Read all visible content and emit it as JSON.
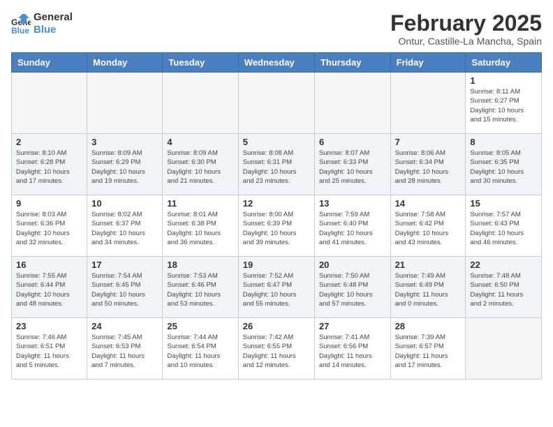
{
  "logo": {
    "line1": "General",
    "line2": "Blue"
  },
  "title": "February 2025",
  "subtitle": "Ontur, Castille-La Mancha, Spain",
  "days_of_week": [
    "Sunday",
    "Monday",
    "Tuesday",
    "Wednesday",
    "Thursday",
    "Friday",
    "Saturday"
  ],
  "weeks": [
    {
      "days": [
        {
          "num": "",
          "info": ""
        },
        {
          "num": "",
          "info": ""
        },
        {
          "num": "",
          "info": ""
        },
        {
          "num": "",
          "info": ""
        },
        {
          "num": "",
          "info": ""
        },
        {
          "num": "",
          "info": ""
        },
        {
          "num": "1",
          "info": "Sunrise: 8:11 AM\nSunset: 6:27 PM\nDaylight: 10 hours\nand 15 minutes."
        }
      ]
    },
    {
      "days": [
        {
          "num": "2",
          "info": "Sunrise: 8:10 AM\nSunset: 6:28 PM\nDaylight: 10 hours\nand 17 minutes."
        },
        {
          "num": "3",
          "info": "Sunrise: 8:09 AM\nSunset: 6:29 PM\nDaylight: 10 hours\nand 19 minutes."
        },
        {
          "num": "4",
          "info": "Sunrise: 8:09 AM\nSunset: 6:30 PM\nDaylight: 10 hours\nand 21 minutes."
        },
        {
          "num": "5",
          "info": "Sunrise: 8:08 AM\nSunset: 6:31 PM\nDaylight: 10 hours\nand 23 minutes."
        },
        {
          "num": "6",
          "info": "Sunrise: 8:07 AM\nSunset: 6:33 PM\nDaylight: 10 hours\nand 25 minutes."
        },
        {
          "num": "7",
          "info": "Sunrise: 8:06 AM\nSunset: 6:34 PM\nDaylight: 10 hours\nand 28 minutes."
        },
        {
          "num": "8",
          "info": "Sunrise: 8:05 AM\nSunset: 6:35 PM\nDaylight: 10 hours\nand 30 minutes."
        }
      ]
    },
    {
      "days": [
        {
          "num": "9",
          "info": "Sunrise: 8:03 AM\nSunset: 6:36 PM\nDaylight: 10 hours\nand 32 minutes."
        },
        {
          "num": "10",
          "info": "Sunrise: 8:02 AM\nSunset: 6:37 PM\nDaylight: 10 hours\nand 34 minutes."
        },
        {
          "num": "11",
          "info": "Sunrise: 8:01 AM\nSunset: 6:38 PM\nDaylight: 10 hours\nand 36 minutes."
        },
        {
          "num": "12",
          "info": "Sunrise: 8:00 AM\nSunset: 6:39 PM\nDaylight: 10 hours\nand 39 minutes."
        },
        {
          "num": "13",
          "info": "Sunrise: 7:59 AM\nSunset: 6:40 PM\nDaylight: 10 hours\nand 41 minutes."
        },
        {
          "num": "14",
          "info": "Sunrise: 7:58 AM\nSunset: 6:42 PM\nDaylight: 10 hours\nand 43 minutes."
        },
        {
          "num": "15",
          "info": "Sunrise: 7:57 AM\nSunset: 6:43 PM\nDaylight: 10 hours\nand 46 minutes."
        }
      ]
    },
    {
      "days": [
        {
          "num": "16",
          "info": "Sunrise: 7:55 AM\nSunset: 6:44 PM\nDaylight: 10 hours\nand 48 minutes."
        },
        {
          "num": "17",
          "info": "Sunrise: 7:54 AM\nSunset: 6:45 PM\nDaylight: 10 hours\nand 50 minutes."
        },
        {
          "num": "18",
          "info": "Sunrise: 7:53 AM\nSunset: 6:46 PM\nDaylight: 10 hours\nand 53 minutes."
        },
        {
          "num": "19",
          "info": "Sunrise: 7:52 AM\nSunset: 6:47 PM\nDaylight: 10 hours\nand 55 minutes."
        },
        {
          "num": "20",
          "info": "Sunrise: 7:50 AM\nSunset: 6:48 PM\nDaylight: 10 hours\nand 57 minutes."
        },
        {
          "num": "21",
          "info": "Sunrise: 7:49 AM\nSunset: 6:49 PM\nDaylight: 11 hours\nand 0 minutes."
        },
        {
          "num": "22",
          "info": "Sunrise: 7:48 AM\nSunset: 6:50 PM\nDaylight: 11 hours\nand 2 minutes."
        }
      ]
    },
    {
      "days": [
        {
          "num": "23",
          "info": "Sunrise: 7:46 AM\nSunset: 6:51 PM\nDaylight: 11 hours\nand 5 minutes."
        },
        {
          "num": "24",
          "info": "Sunrise: 7:45 AM\nSunset: 6:53 PM\nDaylight: 11 hours\nand 7 minutes."
        },
        {
          "num": "25",
          "info": "Sunrise: 7:44 AM\nSunset: 6:54 PM\nDaylight: 11 hours\nand 10 minutes."
        },
        {
          "num": "26",
          "info": "Sunrise: 7:42 AM\nSunset: 6:55 PM\nDaylight: 11 hours\nand 12 minutes."
        },
        {
          "num": "27",
          "info": "Sunrise: 7:41 AM\nSunset: 6:56 PM\nDaylight: 11 hours\nand 14 minutes."
        },
        {
          "num": "28",
          "info": "Sunrise: 7:39 AM\nSunset: 6:57 PM\nDaylight: 11 hours\nand 17 minutes."
        },
        {
          "num": "",
          "info": ""
        }
      ]
    }
  ]
}
